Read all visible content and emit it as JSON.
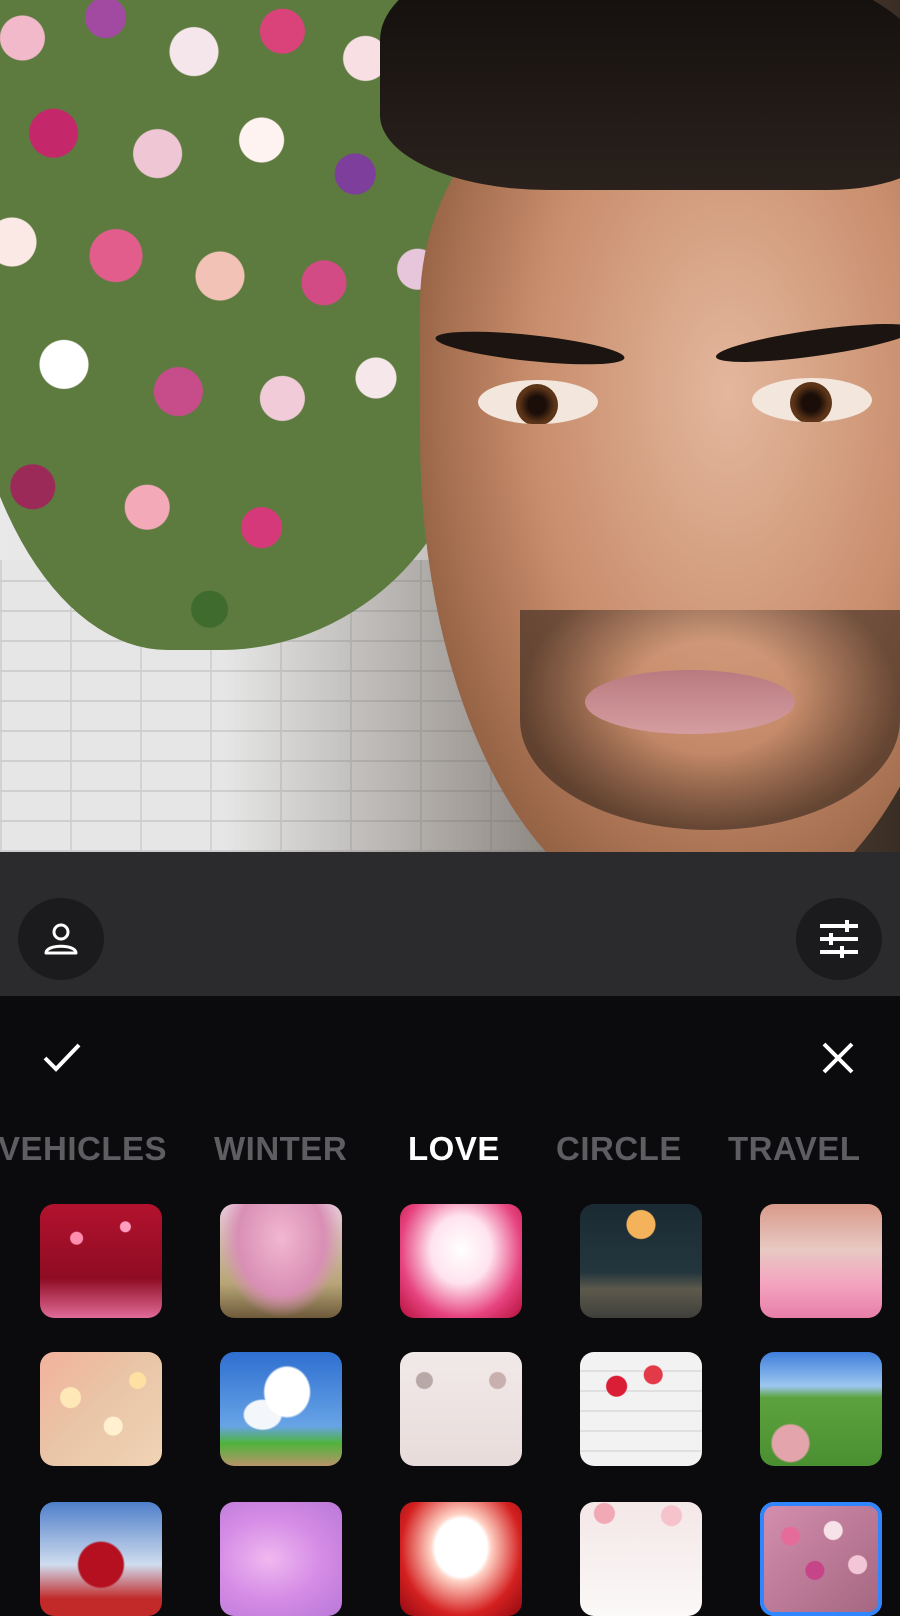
{
  "toolbar": {
    "profile_icon": "person-icon",
    "adjust_icon": "sliders-icon"
  },
  "actions": {
    "confirm_icon": "check-icon",
    "close_icon": "close-icon"
  },
  "categories": [
    "VEHICLES",
    "WINTER",
    "LOVE",
    "CIRCLE",
    "TRAVEL"
  ],
  "active_category": "LOVE",
  "colors": {
    "accent": "#2f86ff",
    "sheet_bg": "#0b0b0d",
    "midbar_bg": "#2b2b2d",
    "tab_inactive": "#5e5e62",
    "tab_active": "#ffffff"
  },
  "backgrounds": [
    {
      "name": "red-bokeh-hearts"
    },
    {
      "name": "pink-blossom-bench"
    },
    {
      "name": "pink-heart-frame"
    },
    {
      "name": "moon-over-sea"
    },
    {
      "name": "pink-tree-path"
    },
    {
      "name": "golden-hearts-bokeh"
    },
    {
      "name": "heart-cloud-sky"
    },
    {
      "name": "balloons-gifts-room"
    },
    {
      "name": "roses-on-wood"
    },
    {
      "name": "picnic-on-grass"
    },
    {
      "name": "heart-tree"
    },
    {
      "name": "purple-haze"
    },
    {
      "name": "white-heart-red-glow"
    },
    {
      "name": "flower-arch-wall"
    },
    {
      "name": "flower-wall",
      "selected": true
    }
  ]
}
